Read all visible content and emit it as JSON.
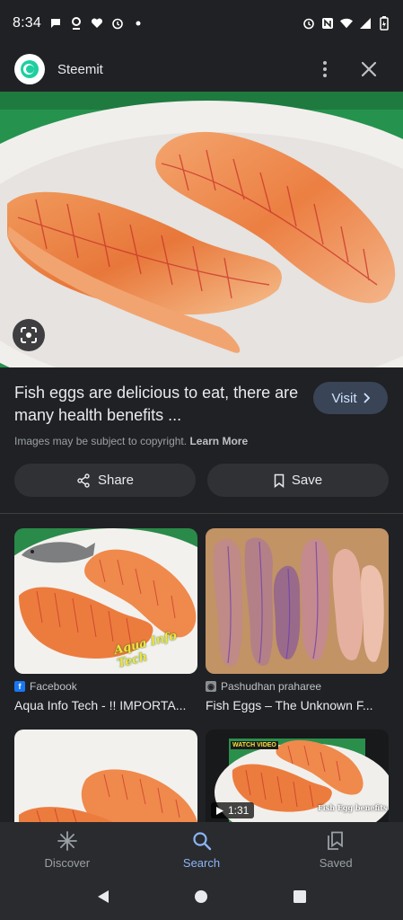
{
  "status_bar": {
    "time": "8:34"
  },
  "app_bar": {
    "site_name": "Steemit"
  },
  "result": {
    "title": "Fish eggs are delicious to eat, there are many health benefits ...",
    "visit_label": "Visit",
    "copyright_text": "Images may be subject to copyright.",
    "learn_more": "Learn More",
    "share_label": "Share",
    "save_label": "Save"
  },
  "related": [
    {
      "source": "Facebook",
      "title": "Aqua Info Tech - !! IMPORTA...",
      "watermark": "Aqua Info Tech"
    },
    {
      "source": "Pashudhan praharee",
      "title": "Fish Eggs – The Unknown F..."
    },
    {
      "source": "",
      "title": ""
    },
    {
      "source": "",
      "title": "",
      "duration": "1:31",
      "watch_label": "WATCH VIDEO",
      "video_caption": "Fish Egg benefits"
    }
  ],
  "bottom_nav": [
    {
      "label": "Discover",
      "icon": "asterisk-icon"
    },
    {
      "label": "Search",
      "icon": "search-icon",
      "active": true
    },
    {
      "label": "Saved",
      "icon": "collections-icon"
    }
  ],
  "colors": {
    "accent": "#8ab4f8",
    "background": "#202124",
    "visit_bg": "#394457"
  }
}
